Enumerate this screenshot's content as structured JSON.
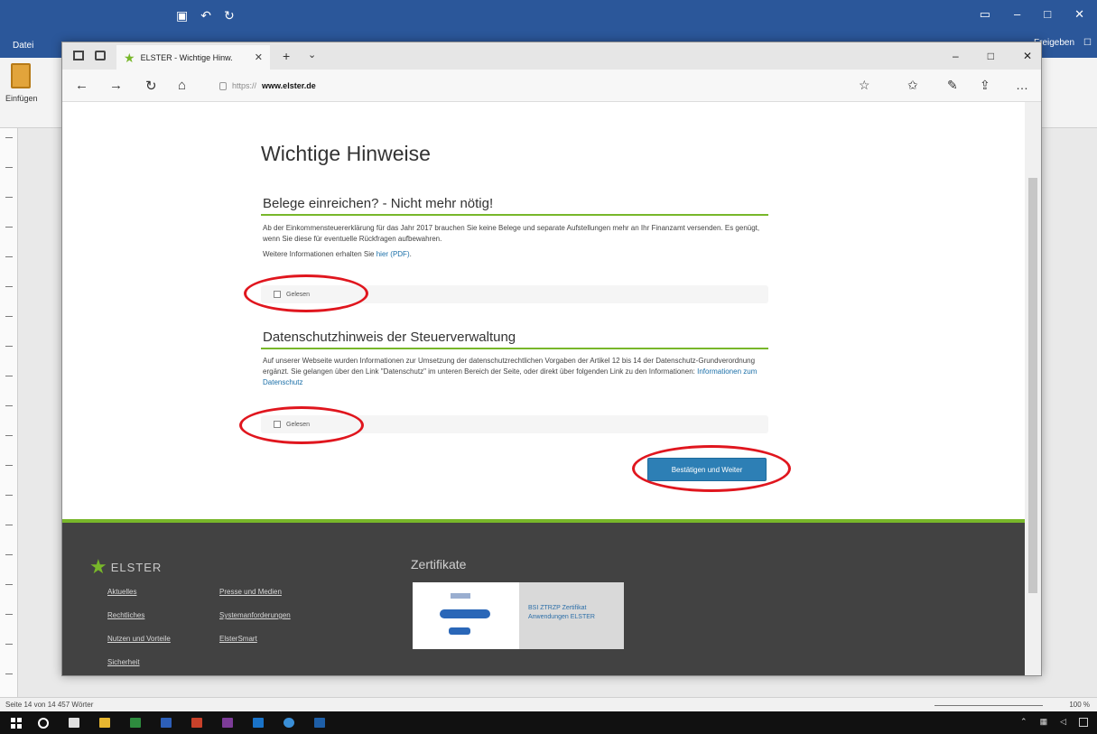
{
  "word": {
    "file_tab": "Datei",
    "paste_label": "Einfügen",
    "share_label": "Freigeben",
    "status_left": "Seite 14 von 14 457 Wörter",
    "zoom": "100 %"
  },
  "browser": {
    "tab_title": "ELSTER - Wichtige Hinw.",
    "url_domain": "www.elster.de",
    "url_prefix": "https://"
  },
  "page": {
    "heading": "Wichtige Hinweise",
    "section1": {
      "title": "Belege einreichen? - Nicht mehr nötig!",
      "text": "Ab der Einkommensteuererklärung für das Jahr 2017 brauchen Sie keine Belege und separate Aufstellungen mehr an Ihr Finanzamt versenden. Es genügt, wenn Sie diese für eventuelle Rückfragen aufbewahren.",
      "more_prefix": "Weitere Informationen erhalten Sie",
      "more_link": "hier (PDF)",
      "more_suffix": ".",
      "checkbox_label": "Gelesen"
    },
    "section2": {
      "title": "Datenschutzhinweis der Steuerverwaltung",
      "text": "Auf unserer Webseite wurden Informationen zur Umsetzung der datenschutzrechtlichen Vorgaben der Artikel 12 bis 14 der Datenschutz-Grundverordnung ergänzt. Sie gelangen über den Link \"Datenschutz\" im unteren Bereich der Seite, oder direkt über folgenden Link zu den Informationen:",
      "link": "Informationen zum Datenschutz",
      "checkbox_label": "Gelesen"
    },
    "confirm_button": "Bestätigen und Weiter"
  },
  "footer": {
    "logo_text": "ELSTER",
    "col1": [
      "Aktuelles",
      "Rechtliches",
      "Nutzen und Vorteile",
      "Sicherheit"
    ],
    "col2": [
      "Presse und Medien",
      "Systemanforderungen",
      "ElsterSmart"
    ],
    "zertifikate_title": "Zertifikate",
    "cert_text": "BSI ZTRZP Zertifikat Anwendungen ELSTER"
  },
  "colors": {
    "elster_green": "#78b72a",
    "button_blue": "#2d7fb5",
    "annotation_red": "#e0161e",
    "word_blue": "#2b579a"
  }
}
